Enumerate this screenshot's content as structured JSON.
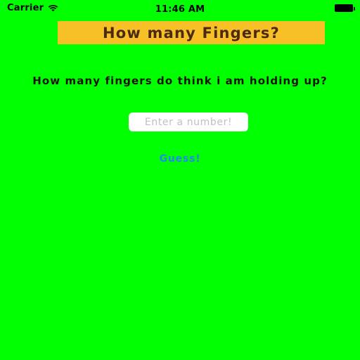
{
  "theme": {
    "background_color": "#00FF00",
    "banner_color": "#F7C026",
    "banner_text_color": "#4A2A10",
    "question_text_color": "#1B1208",
    "input_background": "#FFFFFF",
    "placeholder_color": "#BFC0C4",
    "accent_color": "#2389E8"
  },
  "status_bar": {
    "carrier": "Carrier",
    "wifi_icon": "wifi-icon",
    "time": "11:46 AM",
    "battery_icon": "battery-full-icon"
  },
  "header": {
    "title": "How many Fingers?"
  },
  "main": {
    "question": "How many fingers do think i am holding up?",
    "input": {
      "value": "",
      "placeholder": "Enter a number!"
    },
    "guess_button_label": "Guess!"
  }
}
